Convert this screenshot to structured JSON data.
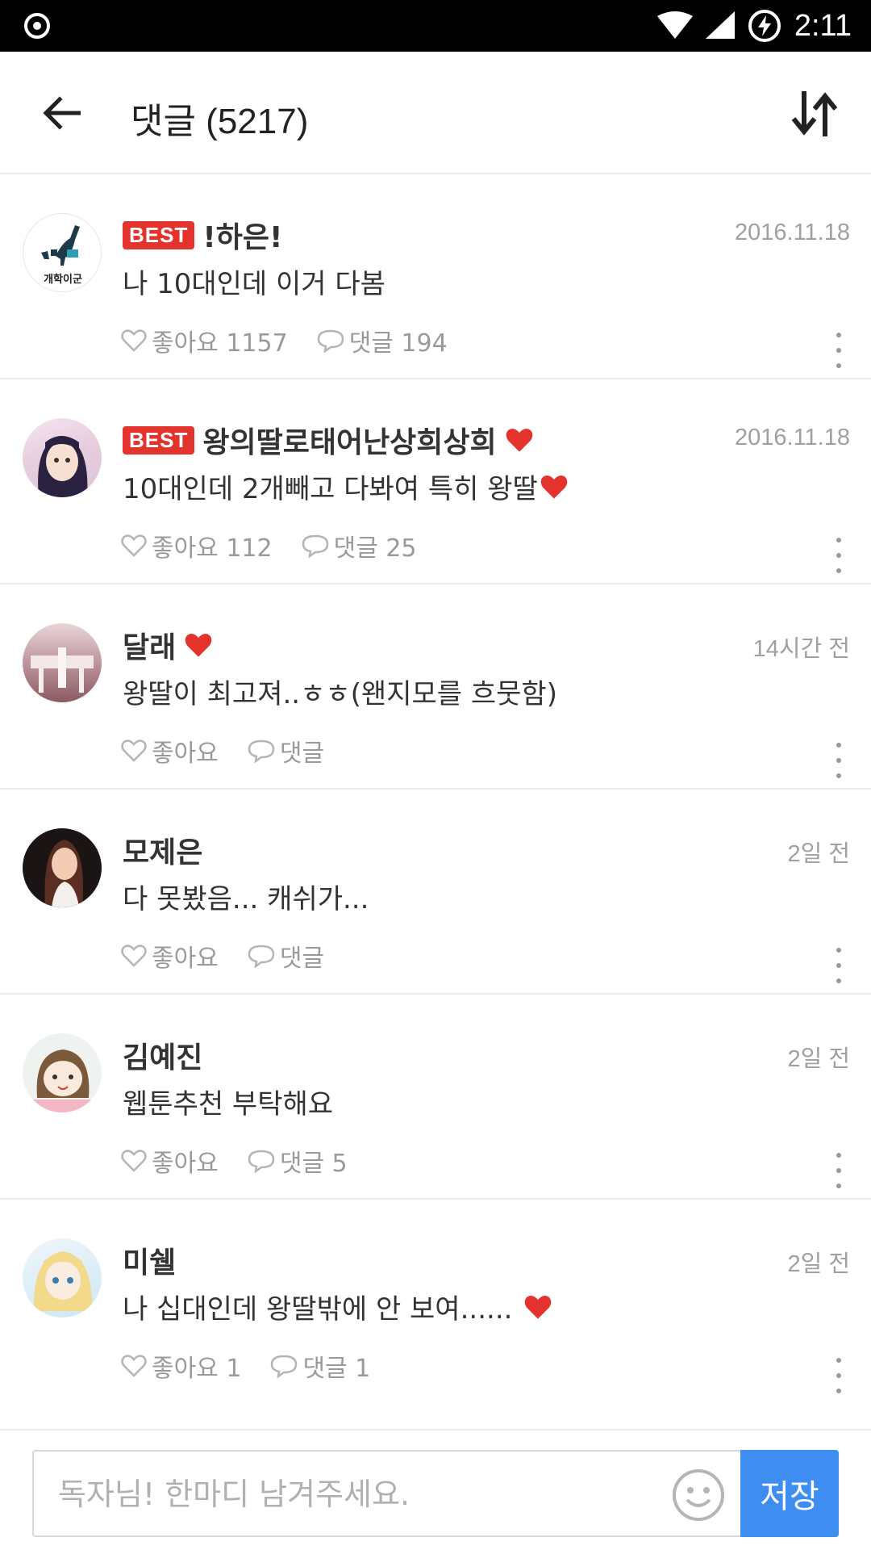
{
  "status_bar": {
    "time": "2:11"
  },
  "header": {
    "title": "댓글 (5217)"
  },
  "comments": [
    {
      "badge": "BEST",
      "name": "!하은!",
      "name_heart": false,
      "date": "2016.11.18",
      "text": "나 10대인데 이거 다봄",
      "text_heart": false,
      "likes": "좋아요 1157",
      "replies": "댓글 194",
      "avatar_label": "개학이군"
    },
    {
      "badge": "BEST",
      "name": "왕의딸로태어난상희상희",
      "name_heart": true,
      "date": "2016.11.18",
      "text": "10대인데 2개빼고 다봐여 특히 왕딸",
      "text_heart": true,
      "likes": "좋아요 112",
      "replies": "댓글 25"
    },
    {
      "badge": "",
      "name": "달래",
      "name_heart": true,
      "date": "14시간 전",
      "text": "왕딸이 최고져..ㅎㅎ(왠지모를 흐뭇함)",
      "text_heart": false,
      "likes": "좋아요",
      "replies": "댓글"
    },
    {
      "badge": "",
      "name": "모제은",
      "name_heart": false,
      "date": "2일 전",
      "text": "다 못봤음... 캐쉬가...",
      "text_heart": false,
      "likes": "좋아요",
      "replies": "댓글"
    },
    {
      "badge": "",
      "name": "김예진",
      "name_heart": false,
      "date": "2일 전",
      "text": "웹툰추천 부탁해요",
      "text_heart": false,
      "likes": "좋아요",
      "replies": "댓글 5"
    },
    {
      "badge": "",
      "name": "미쉘",
      "name_heart": false,
      "date": "2일 전",
      "text": "나 십대인데 왕딸밖에 안 보여......",
      "text_heart": true,
      "likes": "좋아요 1",
      "replies": "댓글 1"
    }
  ],
  "input": {
    "placeholder": "독자님! 한마디 남겨주세요.",
    "value": ""
  },
  "save_label": "저장",
  "colors": {
    "accent": "#3d8ef0",
    "best_badge": "#e4322d",
    "heart": "#e4322d"
  },
  "icons": {
    "back": "arrow-left-icon",
    "sort": "sort-arrows-icon",
    "like": "heart-outline-icon",
    "reply": "speech-bubble-icon",
    "more": "more-vertical-icon",
    "emoji": "smiley-icon"
  }
}
